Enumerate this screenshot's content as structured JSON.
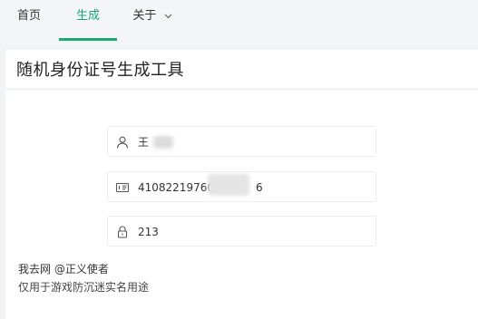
{
  "nav": {
    "home": "首页",
    "generate": "生成",
    "about": "关于"
  },
  "page": {
    "title": "随机身份证号生成工具"
  },
  "form": {
    "name_value": "王",
    "id_value_start": "41082219760",
    "id_value_end": "6",
    "code_value": "213"
  },
  "footer": {
    "line1": "我去网 @正义使者",
    "line2": "仅用于游戏防沉迷实名用途"
  },
  "colors": {
    "accent": "#1aa774",
    "background": "#f2f3f4"
  },
  "icons": {
    "name": "user-icon",
    "id": "id-card-icon",
    "code": "lock-icon",
    "about_menu": "chevron-down-icon"
  }
}
